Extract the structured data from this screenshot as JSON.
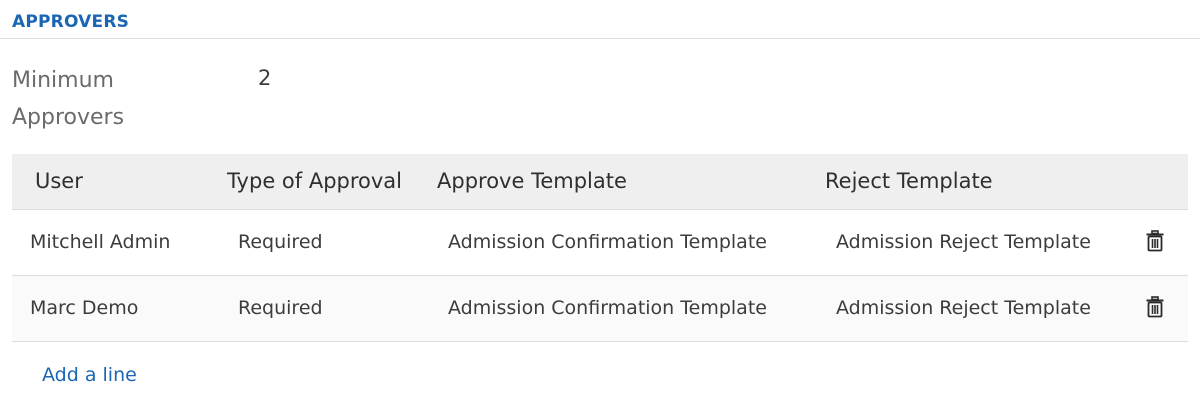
{
  "section": {
    "title": "APPROVERS"
  },
  "minimum_approvers": {
    "label": "Minimum Approvers",
    "value": "2"
  },
  "table": {
    "headers": {
      "user": "User",
      "type": "Type of Approval",
      "approve_template": "Approve Template",
      "reject_template": "Reject Template"
    },
    "rows": [
      {
        "user": "Mitchell Admin",
        "type": "Required",
        "approve_template": "Admission Confirmation Template",
        "reject_template": "Admission Reject Template",
        "delete_icon": "trash-icon"
      },
      {
        "user": "Marc Demo",
        "type": "Required",
        "approve_template": "Admission Confirmation Template",
        "reject_template": "Admission Reject Template",
        "delete_icon": "trash-icon"
      }
    ],
    "add_line_label": "Add a line"
  },
  "colors": {
    "accent": "#1b66b3",
    "header_bg": "#efefef",
    "divider": "#dcdcdc"
  }
}
